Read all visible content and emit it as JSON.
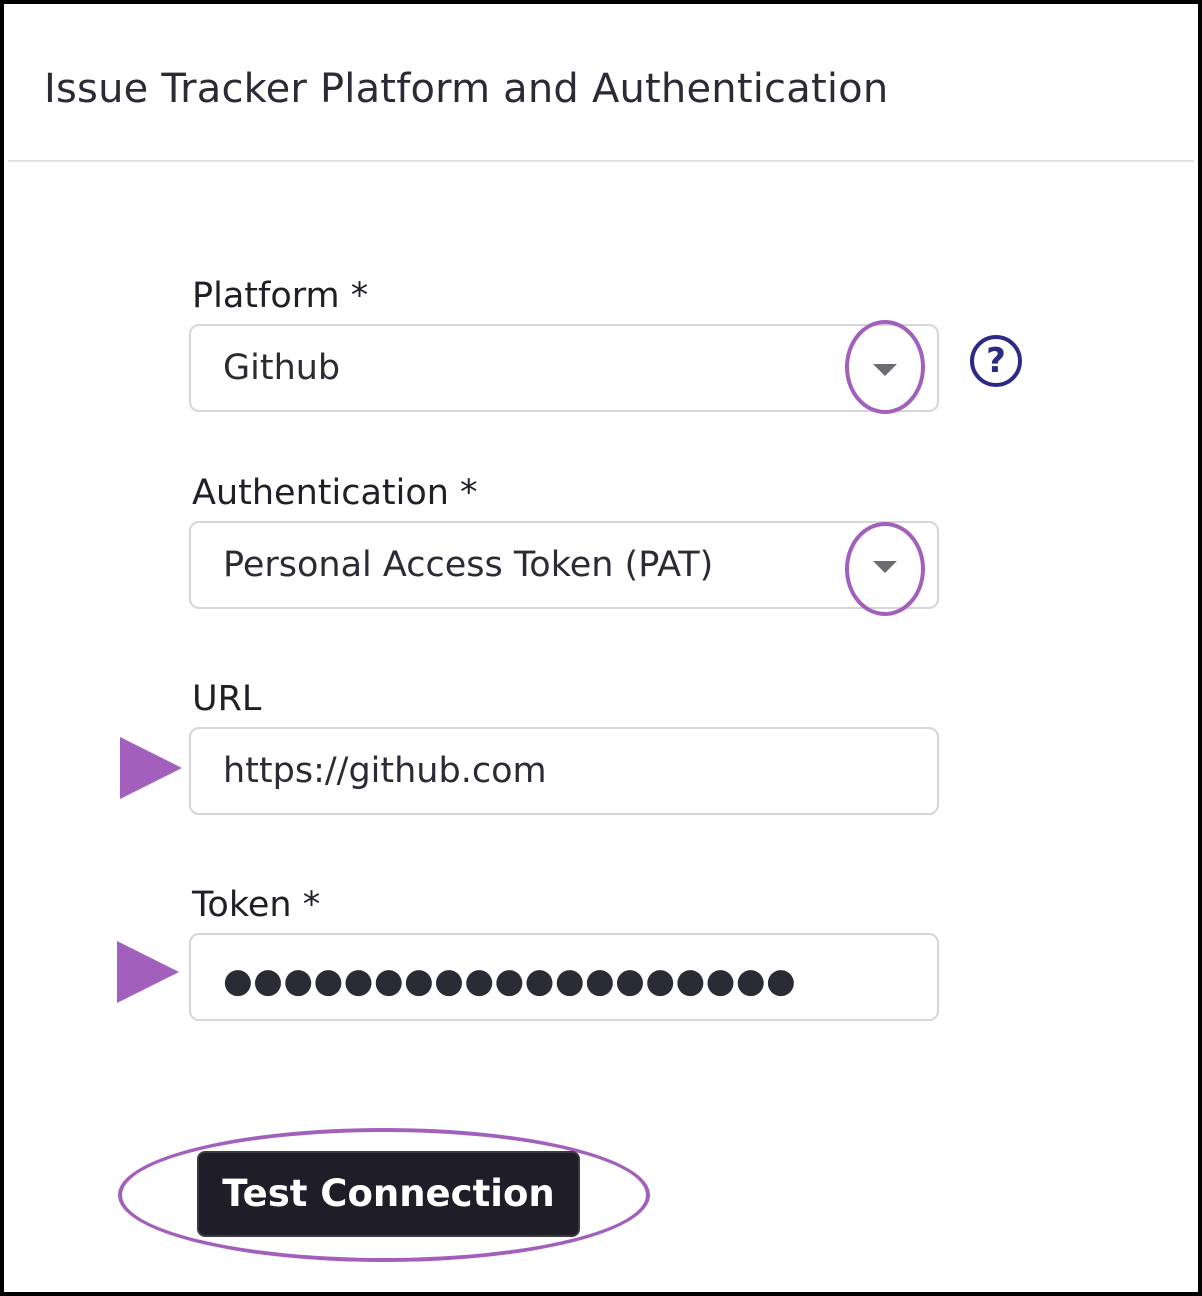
{
  "header": {
    "title": "Issue Tracker Platform and Authentication"
  },
  "platform": {
    "label": "Platform *",
    "value": "Github",
    "help_glyph": "?",
    "help_icon": "question-circle-icon"
  },
  "authentication": {
    "label": "Authentication *",
    "value": "Personal Access Token (PAT)"
  },
  "url": {
    "label": "URL",
    "value": "https://github.com"
  },
  "token": {
    "label": "Token *",
    "value": "●●●●●●●●●●●●●●●●●●●"
  },
  "actions": {
    "test_connection_label": "Test Connection"
  },
  "colors": {
    "annotation": "#a25fbb",
    "button_bg": "#1f1e28",
    "help_icon": "#2d2a86",
    "border": "#d5d5da"
  }
}
